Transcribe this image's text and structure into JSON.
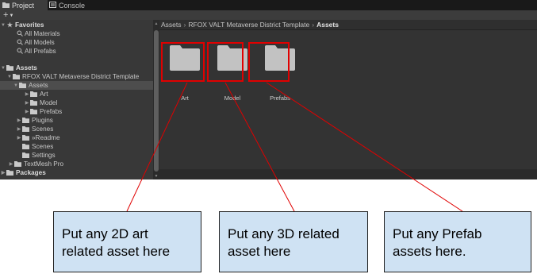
{
  "tabs": [
    {
      "label": "Project",
      "icon": "folder-icon"
    },
    {
      "label": "Console",
      "icon": "console-icon"
    }
  ],
  "toolbar": {
    "create_label": "+",
    "create_icon": "plus-icon"
  },
  "favorites": {
    "title": "Favorites",
    "items": [
      "All Materials",
      "All Models",
      "All Prefabs"
    ]
  },
  "tree": {
    "assets_root": "Assets",
    "template_folder": "RFOX VALT Metaverse District Template",
    "inner_assets": "Assets",
    "inner_children": [
      "Art",
      "Model",
      "Prefabs"
    ],
    "template_children": [
      "Plugins",
      "Scenes",
      "»Readme"
    ],
    "assets_children": [
      "Scenes",
      "Settings",
      "TextMesh Pro"
    ],
    "packages": "Packages"
  },
  "breadcrumb": [
    "Assets",
    "RFOX VALT Metaverse District Template",
    "Assets"
  ],
  "grid_items": [
    {
      "label": "Art"
    },
    {
      "label": "Model"
    },
    {
      "label": "Prefabs"
    }
  ],
  "callouts": [
    {
      "text": "Put any 2D art related asset here"
    },
    {
      "text": "Put any 3D related asset here"
    },
    {
      "text": "Put any Prefab assets here."
    }
  ],
  "colors": {
    "highlight": "#e00000",
    "callout_bg": "#cfe2f3",
    "editor_bg": "#282828"
  }
}
